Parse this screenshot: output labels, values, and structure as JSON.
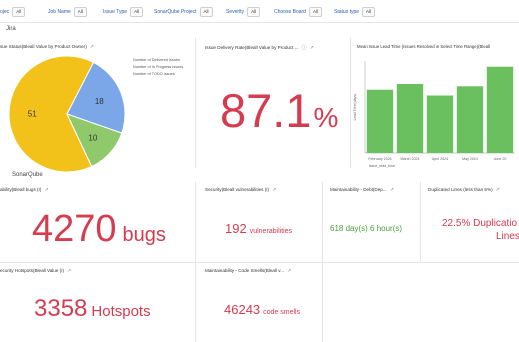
{
  "filters": [
    {
      "label": "ojec",
      "value": "All"
    },
    {
      "label": "Job Name",
      "value": "All"
    },
    {
      "label": "Issue Type",
      "value": "All"
    },
    {
      "label": "SonarQube Project",
      "value": "All"
    },
    {
      "label": "Severity",
      "value": "All"
    },
    {
      "label": "Choose Board",
      "value": "All"
    },
    {
      "label": "Status type",
      "value": "All"
    }
  ],
  "sections": {
    "jira": "Jira",
    "sonar": "SonarQube"
  },
  "panels": {
    "issue_status": {
      "title": "sue Status(Bleall Value by Product Owner)",
      "legend": [
        "Number of Delivered Issues",
        "Number of In Progress Issues",
        "Number of TODO Issues"
      ]
    },
    "delivery_rate": {
      "title": "Issue Delivery Rate(Bleall Value by Product ...",
      "value": "87.1",
      "unit": "%"
    },
    "lead_time": {
      "title": "Mean Issue Lead Time (Issues Resolved in Select Time Range)(Bleall",
      "ylabel": "Lead Time(days)",
      "xlabel": "issue_lead_time"
    },
    "bugs": {
      "title": "ability(Bleall bugs (I)",
      "value": "4270",
      "unit": "bugs"
    },
    "vulnerabilities": {
      "title": "Security(Bleall vulnerabilities (I)",
      "value": "192",
      "unit": "vulnerabilities"
    },
    "debt": {
      "title": "Maintainability - Debt(Dep...",
      "value": "618 day(s) 6 hour(s)"
    },
    "duplicated": {
      "title": "Duplicated Lines (less than 5%)",
      "value": "22.5% Duplicatio",
      "value2": "Lines"
    },
    "hotspots": {
      "title": "ecurity Hotspots(Bleall Value (I)",
      "value": "3358",
      "unit": "Hotspots"
    },
    "code_smells": {
      "title": "Maintainability - Code Smells(Bleall v...",
      "value": "46243",
      "unit": "code smells"
    }
  },
  "chart_data": [
    {
      "type": "pie",
      "categories": [
        "Number of Delivered Issues",
        "Number of In Progress Issues",
        "Number of TODO Issues"
      ],
      "values": [
        51,
        18,
        10
      ],
      "colors": [
        "#f2c21b",
        "#7ba6e8",
        "#8fc96b"
      ]
    },
    {
      "type": "bar",
      "categories": [
        "",
        "February 2024",
        "",
        "March 2024",
        "",
        "April 2024",
        "",
        "May 2024",
        "",
        "June 20"
      ],
      "tick_labels": [
        "February 2024",
        "March 2024",
        "April 2024",
        "May 2024",
        "June 20"
      ],
      "values": [
        55,
        60,
        50,
        58,
        75
      ],
      "ylim": [
        0,
        80
      ],
      "ylabel": "Lead Time(days)",
      "xlabel": "issue_lead_time",
      "color": "#6abf5e"
    }
  ]
}
